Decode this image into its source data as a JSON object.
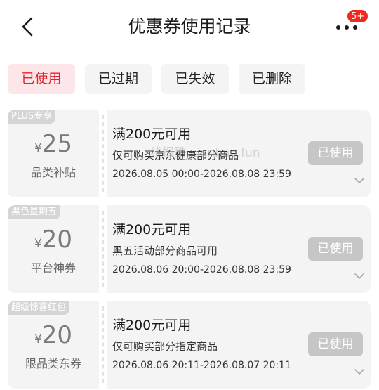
{
  "header": {
    "title": "优惠券使用记录",
    "badge": "5+",
    "back_icon": "chevron-left-icon",
    "more_icon": "ellipsis-icon"
  },
  "filters": [
    {
      "label": "已使用",
      "active": true
    },
    {
      "label": "已过期",
      "active": false
    },
    {
      "label": "已失效",
      "active": false
    },
    {
      "label": "已删除",
      "active": false
    }
  ],
  "coupons": [
    {
      "tag": "PLUS专享",
      "currency": "¥",
      "amount": "25",
      "category": "品类补贴",
      "condition": "满200元可用",
      "description": "仅可购买京东健康部分商品",
      "validity": "2026.08.05 00:00-2026.08.08 23:59",
      "status": "已使用"
    },
    {
      "tag": "黑色星期五",
      "currency": "¥",
      "amount": "20",
      "category": "平台神券",
      "condition": "满200元可用",
      "description": "黑五活动部分商品可用",
      "validity": "2026.08.06 20:00-2026.08.08 23:59",
      "status": "已使用"
    },
    {
      "tag": "超级惊喜红包",
      "currency": "¥",
      "amount": "20",
      "category": "限品类东券",
      "condition": "满200元可用",
      "description": "仅可购买部分指定商品",
      "validity": "2026.08.06 20:11-2026.08.07 20:11",
      "status": "已使用"
    }
  ],
  "watermark": "线报酷 xianbao.fun",
  "colors": {
    "accent": "#e5232c",
    "active_chip_bg": "#fde6ea",
    "badge": "#f2291f",
    "card_bg": "#f4f4f4",
    "used_button": "#c6c6c6"
  }
}
